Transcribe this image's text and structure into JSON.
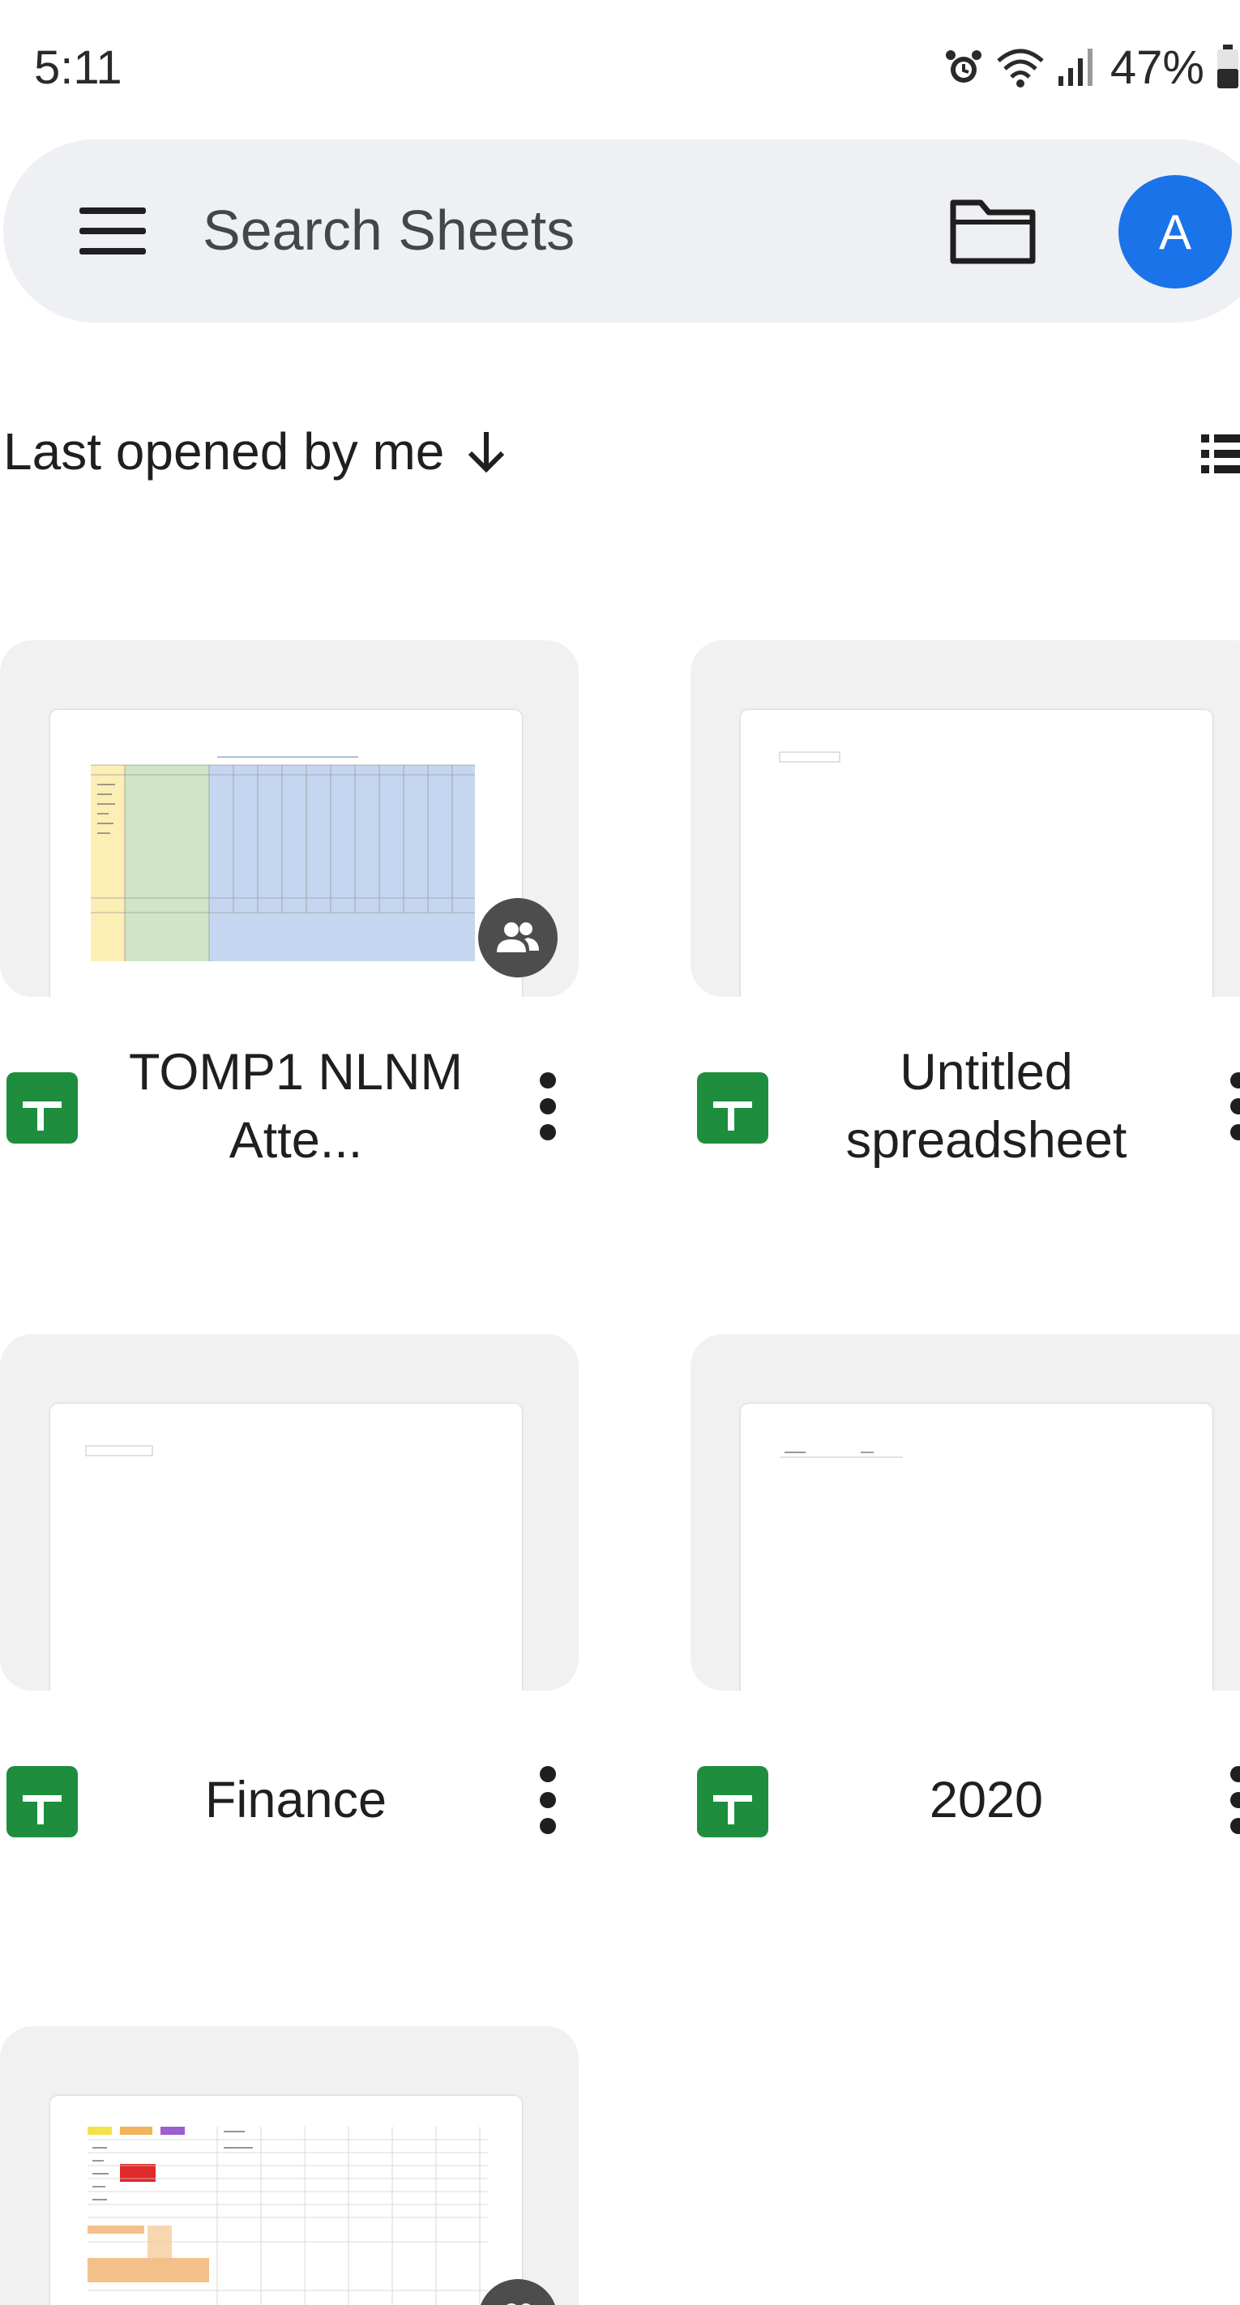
{
  "status_bar": {
    "time": "5:11",
    "battery": "47%",
    "icons": [
      "alarm-icon",
      "wifi-icon",
      "signal-icon",
      "battery-icon"
    ]
  },
  "search": {
    "placeholder": "Search Sheets",
    "menu_icon": "menu-icon",
    "folder_icon": "folder-icon",
    "avatar_letter": "A"
  },
  "sort": {
    "label": "Last opened by me",
    "direction_icon": "arrow-down-icon",
    "view_icon": "list-view-icon"
  },
  "files": [
    {
      "title": "TOMP1 NLNM Atte...",
      "shared": true
    },
    {
      "title": "Untitled spreadsheet",
      "shared": false
    },
    {
      "title": "Finance",
      "shared": false
    },
    {
      "title": "2020",
      "shared": false
    },
    {
      "title": "",
      "shared": true
    }
  ],
  "colors": {
    "sheets_green": "#1e8e3e",
    "avatar_blue": "#1a73e8",
    "search_bg": "#eef0f4",
    "card_bg": "#f1f1f2"
  }
}
